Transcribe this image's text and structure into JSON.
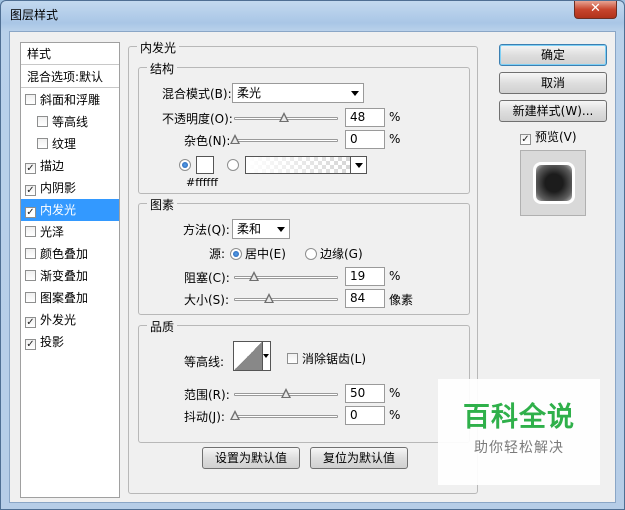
{
  "window": {
    "title": "图层样式"
  },
  "styles_list": {
    "header": "样式",
    "blend_options": "混合选项:默认",
    "items": [
      {
        "label": "斜面和浮雕",
        "checked": false
      },
      {
        "label": "等高线",
        "checked": false
      },
      {
        "label": "纹理",
        "checked": false
      },
      {
        "label": "描边",
        "checked": true
      },
      {
        "label": "内阴影",
        "checked": true
      },
      {
        "label": "内发光",
        "checked": true
      },
      {
        "label": "光泽",
        "checked": false
      },
      {
        "label": "颜色叠加",
        "checked": false
      },
      {
        "label": "渐变叠加",
        "checked": false
      },
      {
        "label": "图案叠加",
        "checked": false
      },
      {
        "label": "外发光",
        "checked": true
      },
      {
        "label": "投影",
        "checked": true
      }
    ],
    "check_mark": "✓"
  },
  "panel": {
    "title": "内发光",
    "structure": {
      "title": "结构",
      "blend_mode_label": "混合模式(B):",
      "blend_mode_value": "柔光",
      "opacity_label": "不透明度(O):",
      "opacity_value": "48",
      "opacity_fraction": 0.48,
      "opacity_unit": "%",
      "noise_label": "杂色(N):",
      "noise_value": "0",
      "noise_fraction": 0.0,
      "noise_unit": "%",
      "color_hex_label": "#ffffff"
    },
    "elements": {
      "title": "图素",
      "technique_label": "方法(Q):",
      "technique_value": "柔和",
      "source_label": "源:",
      "source_center": "居中(E)",
      "source_edge": "边缘(G)",
      "choke_label": "阻塞(C):",
      "choke_value": "19",
      "choke_fraction": 0.19,
      "choke_unit": "%",
      "size_label": "大小(S):",
      "size_value": "84",
      "size_fraction": 0.336,
      "size_unit": "像素"
    },
    "quality": {
      "title": "品质",
      "contour_label": "等高线:",
      "antialias_label": "消除锯齿(L)",
      "range_label": "范围(R):",
      "range_value": "50",
      "range_fraction": 0.5,
      "range_unit": "%",
      "jitter_label": "抖动(J):",
      "jitter_value": "0",
      "jitter_fraction": 0.0,
      "jitter_unit": "%"
    },
    "make_default_label": "设置为默认值",
    "reset_default_label": "复位为默认值"
  },
  "actions": {
    "ok_label": "确定",
    "cancel_label": "取消",
    "new_style_label": "新建样式(W)...",
    "preview_label": "预览(V)",
    "preview_checked": true
  },
  "watermark": {
    "title": "百科全说",
    "subtitle": "助你轻松解决"
  }
}
